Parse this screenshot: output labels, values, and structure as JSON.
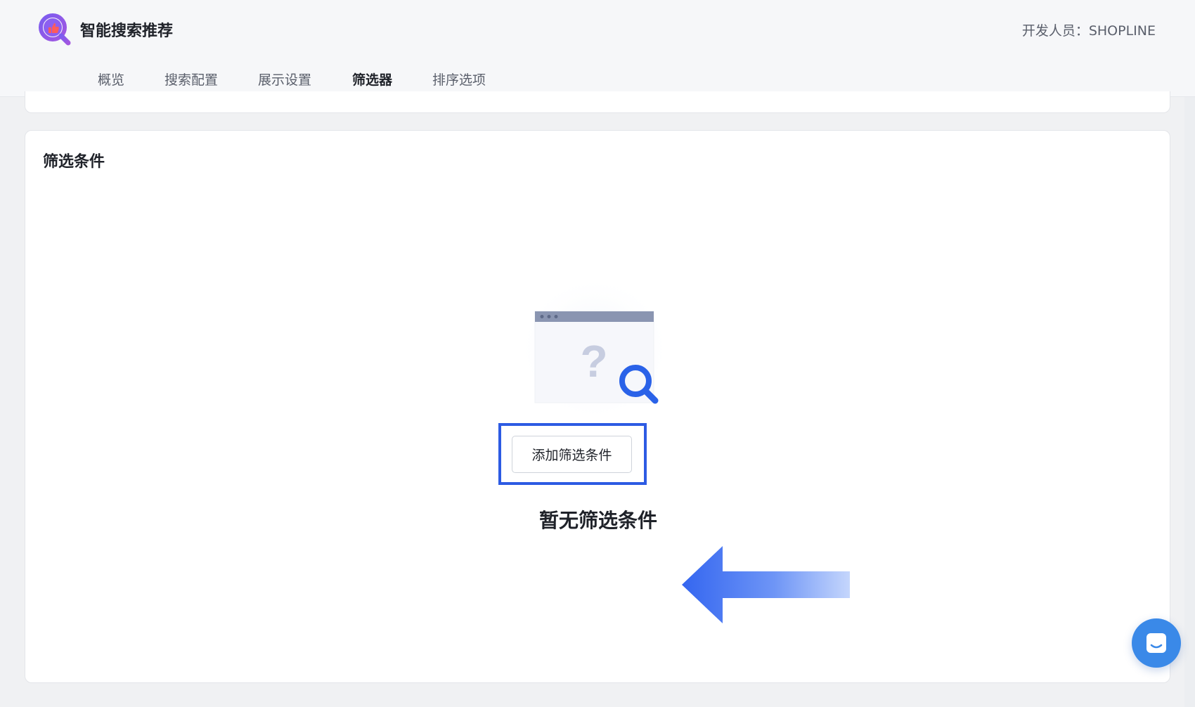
{
  "header": {
    "app_title": "智能搜索推荐",
    "developer_label": "开发人员：SHOPLINE",
    "logo_icon": "thumbs-up-search-logo"
  },
  "tabs": [
    {
      "label": "概览",
      "active": false
    },
    {
      "label": "搜索配置",
      "active": false
    },
    {
      "label": "展示设置",
      "active": false
    },
    {
      "label": "筛选器",
      "active": true
    },
    {
      "label": "排序选项",
      "active": false
    }
  ],
  "filter_card": {
    "title": "筛选条件",
    "empty_state_text": "暂无筛选条件",
    "add_button_label": "添加筛选条件",
    "illustration_icon": "browser-question-search-icon"
  },
  "colors": {
    "accent": "#3b63e6",
    "highlight": "#2d5be3",
    "chat": "#3a89e8"
  },
  "chat_icon": "chat-bubble-icon"
}
